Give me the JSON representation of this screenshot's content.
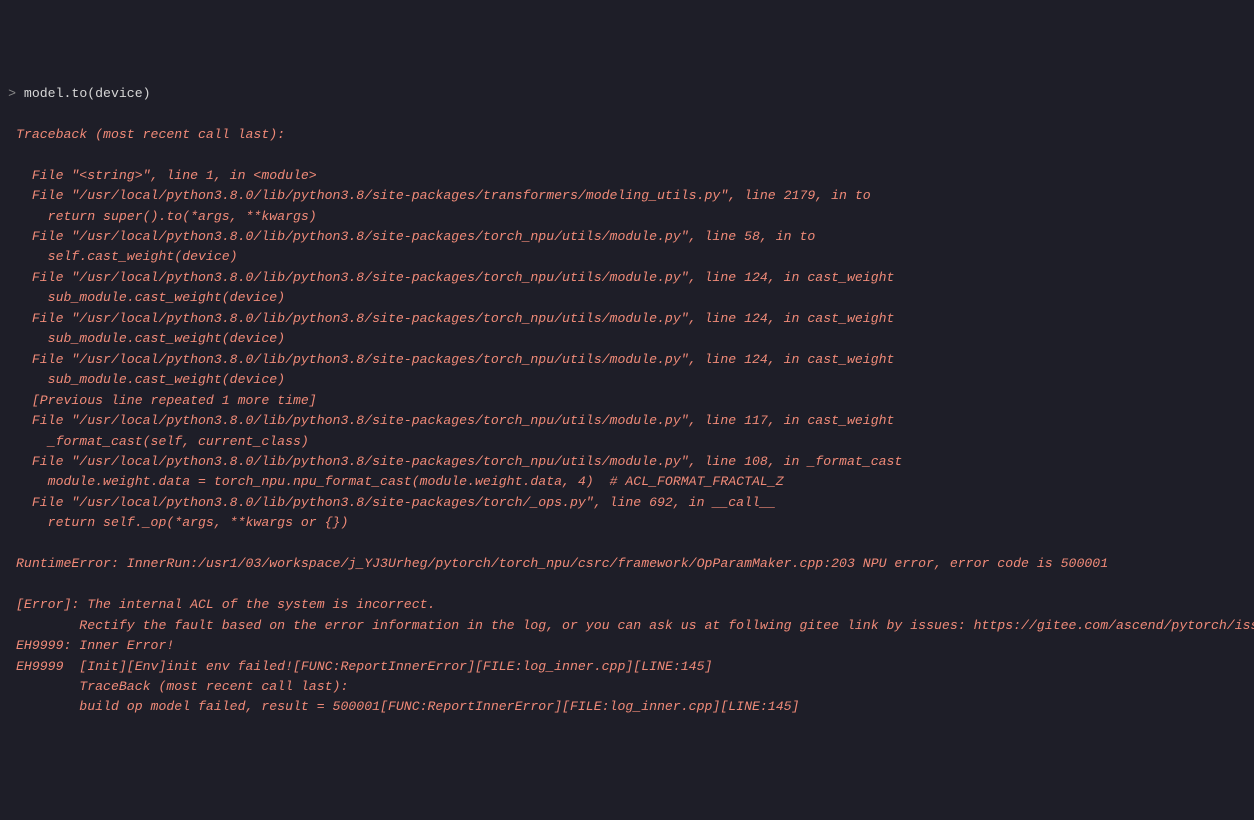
{
  "prompt": {
    "symbol": ">",
    "input": "model.to(device)"
  },
  "traceback": {
    "header": "Traceback (most recent call last):",
    "frames": [
      {
        "loc": "  File \"<string>\", line 1, in <module>",
        "code": ""
      },
      {
        "loc": "  File \"/usr/local/python3.8.0/lib/python3.8/site-packages/transformers/modeling_utils.py\", line 2179, in to",
        "code": "    return super().to(*args, **kwargs)"
      },
      {
        "loc": "  File \"/usr/local/python3.8.0/lib/python3.8/site-packages/torch_npu/utils/module.py\", line 58, in to",
        "code": "    self.cast_weight(device)"
      },
      {
        "loc": "  File \"/usr/local/python3.8.0/lib/python3.8/site-packages/torch_npu/utils/module.py\", line 124, in cast_weight",
        "code": "    sub_module.cast_weight(device)"
      },
      {
        "loc": "  File \"/usr/local/python3.8.0/lib/python3.8/site-packages/torch_npu/utils/module.py\", line 124, in cast_weight",
        "code": "    sub_module.cast_weight(device)"
      },
      {
        "loc": "  File \"/usr/local/python3.8.0/lib/python3.8/site-packages/torch_npu/utils/module.py\", line 124, in cast_weight",
        "code": "    sub_module.cast_weight(device)"
      },
      {
        "loc": "  [Previous line repeated 1 more time]",
        "code": ""
      },
      {
        "loc": "  File \"/usr/local/python3.8.0/lib/python3.8/site-packages/torch_npu/utils/module.py\", line 117, in cast_weight",
        "code": "    _format_cast(self, current_class)"
      },
      {
        "loc": "  File \"/usr/local/python3.8.0/lib/python3.8/site-packages/torch_npu/utils/module.py\", line 108, in _format_cast",
        "code": "    module.weight.data = torch_npu.npu_format_cast(module.weight.data, 4)  # ACL_FORMAT_FRACTAL_Z"
      },
      {
        "loc": "  File \"/usr/local/python3.8.0/lib/python3.8/site-packages/torch/_ops.py\", line 692, in __call__",
        "code": "    return self._op(*args, **kwargs or {})"
      }
    ],
    "exception": "RuntimeError: InnerRun:/usr1/03/workspace/j_YJ3Urheg/pytorch/torch_npu/csrc/framework/OpParamMaker.cpp:203 NPU error, error code is 500001",
    "post": [
      "[Error]: The internal ACL of the system is incorrect.",
      "        Rectify the fault based on the error information in the log, or you can ask us at follwing gitee link by issues: https://gitee.com/ascend/pytorch/issue",
      "EH9999: Inner Error!",
      "EH9999  [Init][Env]init env failed![FUNC:ReportInnerError][FILE:log_inner.cpp][LINE:145]",
      "        TraceBack (most recent call last):",
      "        build op model failed, result = 500001[FUNC:ReportInnerError][FILE:log_inner.cpp][LINE:145]"
    ]
  }
}
